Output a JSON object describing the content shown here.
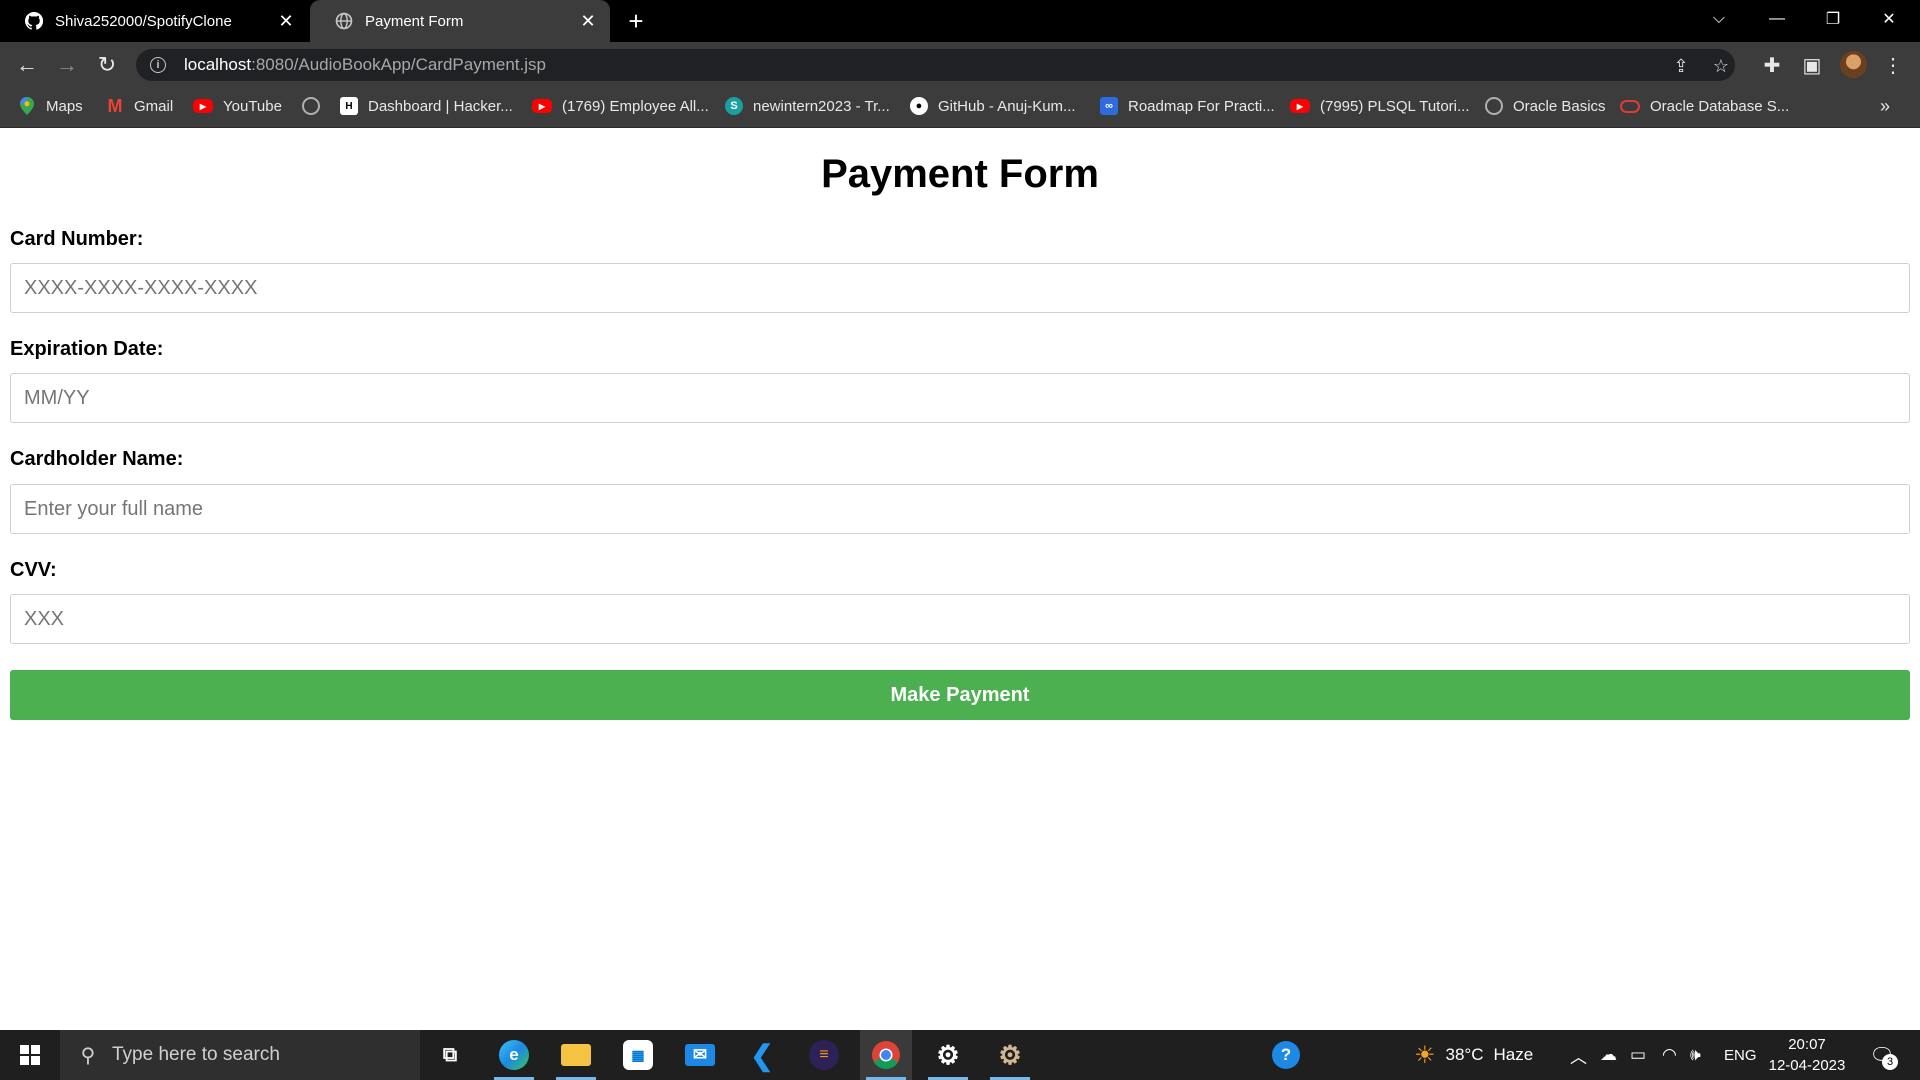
{
  "browser": {
    "tabs": [
      {
        "title": "Shiva252000/SpotifyClone",
        "icon": "github-icon",
        "active": false
      },
      {
        "title": "Payment Form",
        "icon": "globe-icon",
        "active": true
      }
    ],
    "address": {
      "host": "localhost",
      "path": ":8080/AudioBookApp/CardPayment.jsp"
    },
    "bookmarks": [
      {
        "label": "Maps",
        "icon": "maps-icon"
      },
      {
        "label": "Gmail",
        "icon": "gmail-icon"
      },
      {
        "label": "YouTube",
        "icon": "youtube-icon"
      },
      {
        "label": "",
        "icon": "globe-icon"
      },
      {
        "label": "Dashboard | Hacker...",
        "icon": "hackerrank-icon"
      },
      {
        "label": "(1769) Employee All...",
        "icon": "youtube-icon"
      },
      {
        "label": "newintern2023 - Tr...",
        "icon": "trello-icon"
      },
      {
        "label": "GitHub - Anuj-Kum...",
        "icon": "github-icon"
      },
      {
        "label": "Roadmap For Practi...",
        "icon": "roadmap-icon"
      },
      {
        "label": "(7995) PLSQL Tutori...",
        "icon": "youtube-icon"
      },
      {
        "label": "Oracle Basics",
        "icon": "globe-icon"
      },
      {
        "label": "Oracle Database S...",
        "icon": "oracle-icon"
      }
    ],
    "bookmarks_more": "»"
  },
  "form": {
    "title": "Payment Form",
    "fields": [
      {
        "label": "Card Number:",
        "placeholder": "XXXX-XXXX-XXXX-XXXX",
        "value": ""
      },
      {
        "label": "Expiration Date:",
        "placeholder": "MM/YY",
        "value": ""
      },
      {
        "label": "Cardholder Name:",
        "placeholder": "Enter your full name",
        "value": ""
      },
      {
        "label": "CVV:",
        "placeholder": "XXX",
        "value": ""
      }
    ],
    "submit_label": "Make Payment",
    "submit_color": "#4caf50"
  },
  "taskbar": {
    "search_placeholder": "Type here to search",
    "apps": [
      "task-view-icon",
      "edge-icon",
      "file-explorer-icon",
      "store-icon",
      "mail-icon",
      "vscode-icon",
      "eclipse-icon",
      "chrome-icon",
      "settings-icon",
      "gear-app-icon"
    ],
    "weather": {
      "temp": "38°C",
      "condition": "Haze"
    },
    "language": "ENG",
    "time": "20:07",
    "date": "12-04-2023",
    "notification_count": "3"
  }
}
